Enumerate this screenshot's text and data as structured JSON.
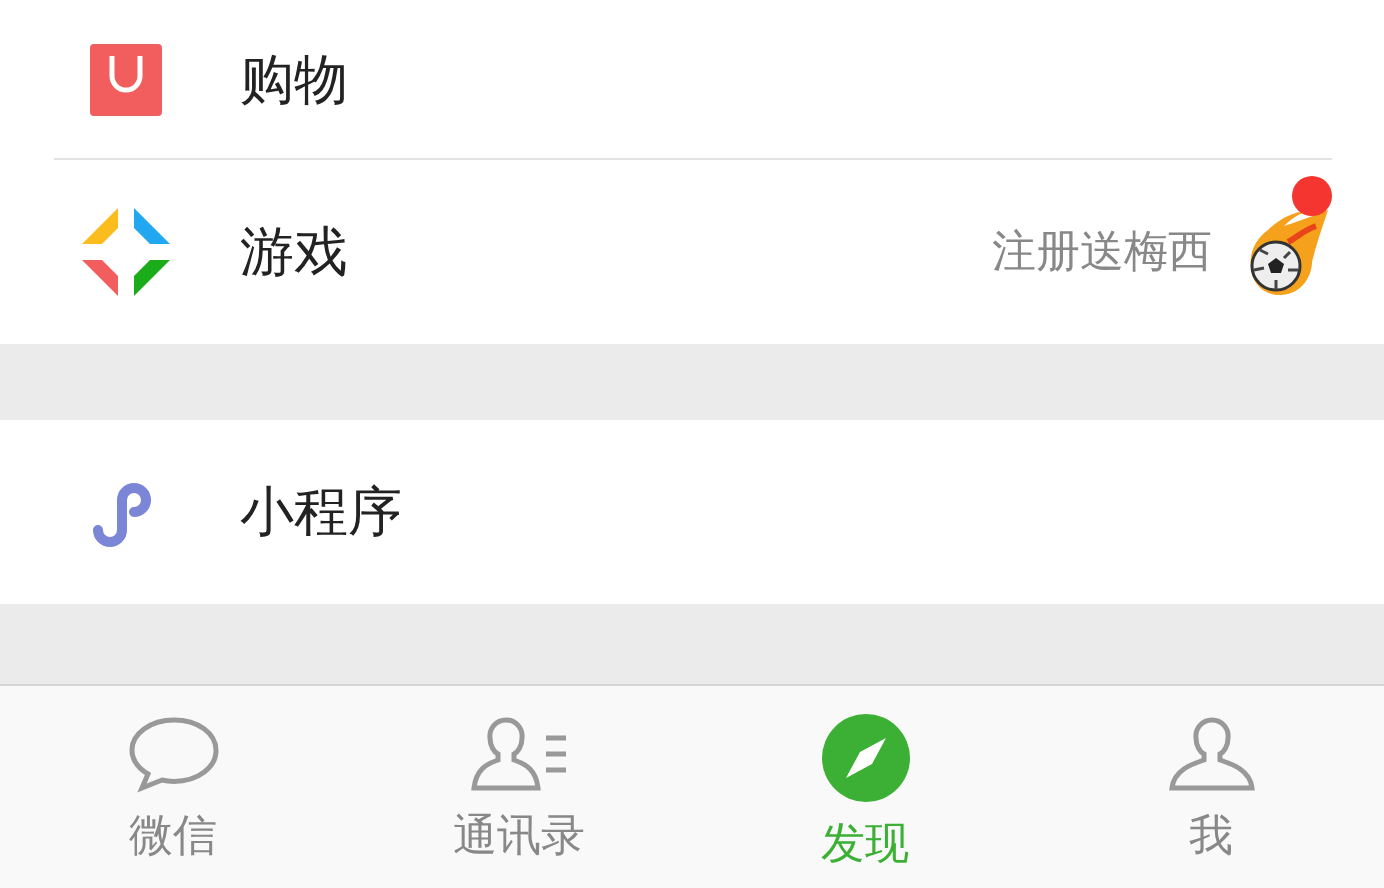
{
  "groups": [
    {
      "items": [
        {
          "label": "购物",
          "kind": "bag"
        },
        {
          "label": "游戏",
          "kind": "game",
          "note": "注册送梅西",
          "unread": true
        }
      ]
    },
    {
      "items": [
        {
          "label": "小程序",
          "kind": "miniapp"
        }
      ]
    }
  ],
  "tabs": [
    {
      "label": "微信",
      "kind": "chat",
      "selected": false
    },
    {
      "label": "通讯录",
      "kind": "contacts",
      "selected": false
    },
    {
      "label": "发现",
      "kind": "compass",
      "selected": true
    },
    {
      "label": "我",
      "kind": "me",
      "selected": false
    }
  ]
}
